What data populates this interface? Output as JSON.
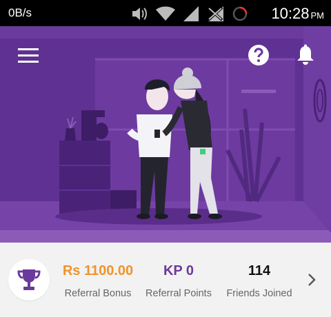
{
  "status_bar": {
    "network_speed": "0B/s",
    "time": "10:28",
    "ampm": "PM",
    "icons": [
      "volume-icon",
      "wifi-icon",
      "signal-icon",
      "no-data-icon",
      "loading-icon"
    ]
  },
  "header": {
    "menu_icon": "hamburger-menu-icon",
    "help_icon": "help-icon",
    "notification_icon": "bell-icon"
  },
  "stats": {
    "trophy_icon": "trophy-icon",
    "referral_bonus": {
      "value": "Rs 1100.00",
      "label": "Referral Bonus"
    },
    "referral_points": {
      "value": "KP 0",
      "label": "Referral Points"
    },
    "friends_joined": {
      "value": "114",
      "label": "Friends Joined"
    },
    "more_icon": "chevron-right-icon"
  },
  "colors": {
    "primary_purple": "#6a3a9c",
    "bonus_orange": "#f0932b",
    "background_light": "#f2f2f2"
  }
}
